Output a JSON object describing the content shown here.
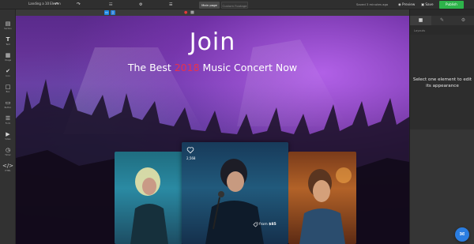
{
  "topbar": {
    "page_title": "Landing a 10 Eleven",
    "undo_icon": "undo-icon",
    "redo_icon": "redo-icon",
    "tabs": [
      {
        "label": "Main page"
      },
      {
        "label": "Custom Footage"
      }
    ],
    "saved_text": "Saved 3 minutes ago",
    "preview_label": "Preview",
    "save_label": "Save",
    "publish_label": "Publish"
  },
  "strip": {
    "desktop_icon": "desktop-icon",
    "mobile_icon": "mobile-icon"
  },
  "toolbar": {
    "items": [
      {
        "label": "Section",
        "icon": "section-icon"
      },
      {
        "label": "Text",
        "icon": "text-icon"
      },
      {
        "label": "Image",
        "icon": "image-icon"
      },
      {
        "label": "Icon",
        "icon": "check-circle-icon"
      },
      {
        "label": "Box",
        "icon": "box-icon"
      },
      {
        "label": "Button",
        "icon": "button-icon"
      },
      {
        "label": "Form",
        "icon": "form-icon"
      },
      {
        "label": "Video",
        "icon": "video-icon"
      },
      {
        "label": "Timer",
        "icon": "clock-icon"
      },
      {
        "label": "HTML",
        "icon": "code-icon"
      }
    ]
  },
  "hero": {
    "title": "Join",
    "subtitle_before": "The Best ",
    "subtitle_year": "2018",
    "subtitle_after": " Music Concert Now",
    "accent_color": "#e8314d"
  },
  "card": {
    "likes": "2,568",
    "price_prefix": "from ",
    "price": "$85"
  },
  "panel": {
    "layers_label": "Layouts",
    "message": "Select one element to edit its appearance"
  },
  "colors": {
    "publish": "#2db34a",
    "device_active": "#1e88e5",
    "chat": "#2a7de1"
  }
}
